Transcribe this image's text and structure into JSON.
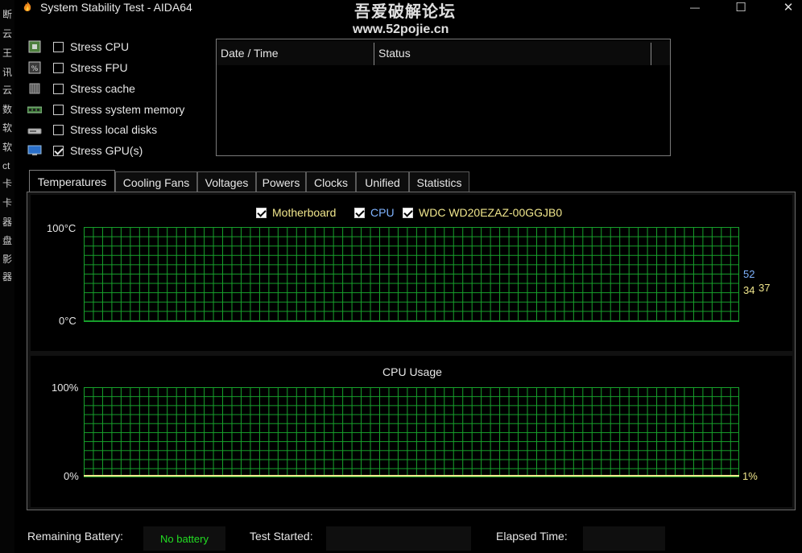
{
  "window": {
    "title": "System Stability Test - AIDA64",
    "watermark_line1": "吾爱破解论坛",
    "watermark_line2": "www.52pojie.cn",
    "controls": {
      "minimize": "—",
      "maximize": "☐",
      "close": "✕"
    }
  },
  "left_strip_chars": [
    "断",
    "云",
    "王",
    "讯",
    "云",
    "数",
    "软",
    "软",
    "ct",
    "卡",
    "卡",
    "器",
    "盘",
    "影",
    "器"
  ],
  "stress": [
    {
      "label": "Stress CPU",
      "checked": false,
      "icon": "cpu-chip-icon"
    },
    {
      "label": "Stress FPU",
      "checked": false,
      "icon": "fpu-chip-icon"
    },
    {
      "label": "Stress cache",
      "checked": false,
      "icon": "cache-chip-icon"
    },
    {
      "label": "Stress system memory",
      "checked": false,
      "icon": "memory-module-icon"
    },
    {
      "label": "Stress local disks",
      "checked": false,
      "icon": "disk-drive-icon"
    },
    {
      "label": "Stress GPU(s)",
      "checked": true,
      "icon": "gpu-monitor-icon"
    }
  ],
  "log": {
    "col_datetime": "Date / Time",
    "col_status": "Status"
  },
  "tabs": [
    "Temperatures",
    "Cooling Fans",
    "Voltages",
    "Powers",
    "Clocks",
    "Unified",
    "Statistics"
  ],
  "active_tab": "Temperatures",
  "temperature_graph": {
    "legend": [
      {
        "label": "Motherboard",
        "color": "#f0e68c",
        "checked": true
      },
      {
        "label": "CPU",
        "color": "#7fb3ff",
        "checked": true
      },
      {
        "label": "WDC WD20EZAZ-00GGJB0",
        "color": "#f0e68c",
        "checked": true
      }
    ],
    "y_max_label": "100°C",
    "y_min_label": "0°C",
    "readings": [
      {
        "value": "52",
        "color": "#7fb3ff"
      },
      {
        "value": "34",
        "color": "#f0e68c"
      },
      {
        "value": "37",
        "color": "#f0e68c"
      }
    ]
  },
  "cpu_graph": {
    "title": "CPU Usage",
    "y_max_label": "100%",
    "y_min_label": "0%",
    "reading": "1%",
    "reading_color": "#f0e68c"
  },
  "footer": {
    "battery_label": "Remaining Battery:",
    "battery_value": "No battery",
    "battery_color": "#22dd22",
    "test_started_label": "Test Started:",
    "test_started_value": "",
    "elapsed_label": "Elapsed Time:",
    "elapsed_value": ""
  }
}
